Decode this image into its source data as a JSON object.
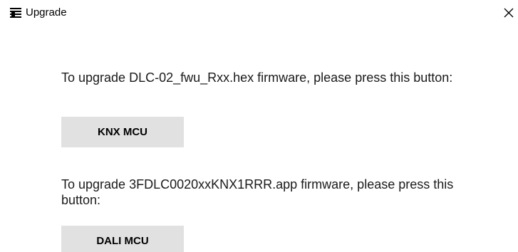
{
  "window": {
    "title": "Upgrade",
    "close_icon": "close-icon",
    "app_icon": "upgrade-window-icon"
  },
  "main": {
    "knx": {
      "message": "To upgrade DLC-02_fwu_Rxx.hex firmware, please press this button:",
      "button_label": "KNX MCU"
    },
    "dali": {
      "message": "To upgrade 3FDLC0020xxKNX1RRR.app firmware, please press this button:",
      "button_label": "DALI MCU"
    }
  },
  "colors": {
    "button_bg": "#e1e1e1",
    "background": "#ffffff",
    "text": "#1a1a1a"
  }
}
